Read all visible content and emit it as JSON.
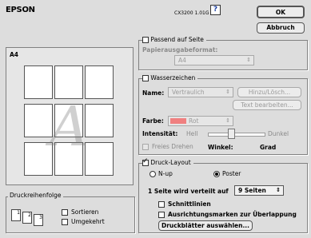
{
  "brand": "EPSON",
  "model": "CX3200 1.01G",
  "help_label": "?",
  "ok_label": "OK",
  "cancel_label": "Abbruch",
  "preview": {
    "paper": "A4",
    "watermark_letter": "A"
  },
  "print_order": {
    "title": "Druckreihenfolge",
    "sort_label": "Sortieren",
    "reverse_label": "Umgekehrt",
    "icon_numbers": [
      "1",
      "2",
      "3"
    ]
  },
  "fit_page": {
    "label": "Passend auf Seite",
    "paper_output_label": "Papierausgabeformat:",
    "paper_output_value": "A4"
  },
  "watermark": {
    "label": "Wasserzeichen",
    "name_label": "Name:",
    "name_value": "Vertraulich",
    "add_delete_label": "Hinzu/Lösch...",
    "edit_text_label": "Text bearbeiten...",
    "color_label": "Farbe:",
    "color_value": "Rot",
    "color_swatch": "#f08080",
    "intensity_label": "Intensität:",
    "light_label": "Hell",
    "dark_label": "Dunkel",
    "free_rotate_label": "Freies Drehen",
    "angle_label": "Winkel:",
    "degree_label": "Grad"
  },
  "layout": {
    "label": "Druck-Layout",
    "nup_label": "N-up",
    "poster_label": "Poster",
    "split_label": "1 Seite wird verteilt auf",
    "split_value": "9 Seiten",
    "cut_lines_label": "Schnittlinien",
    "marks_label": "Ausrichtungsmarken zur Überlappung",
    "select_sheets_label": "Druckblätter auswählen..."
  }
}
